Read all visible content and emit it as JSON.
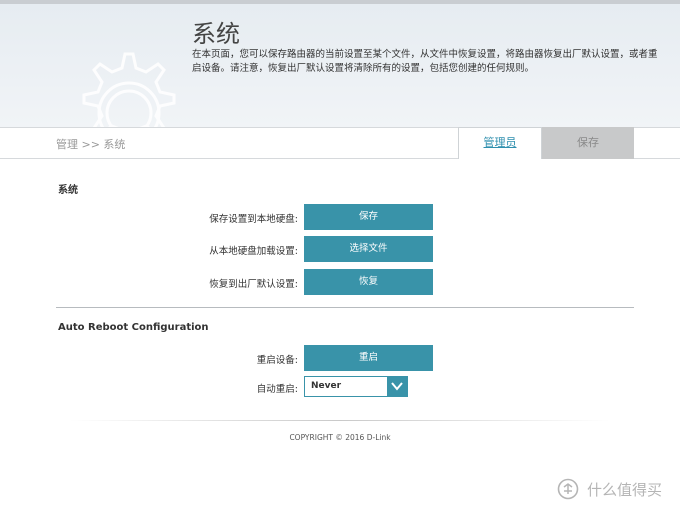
{
  "header": {
    "title": "系统",
    "description": "在本页面，您可以保存路由器的当前设置至某个文件，从文件中恢复设置，将路由器恢复出厂默认设置，或者重启设备。请注意，恢复出厂默认设置将清除所有的设置，包括您创建的任何规则。"
  },
  "breadcrumb": {
    "text": "管理 >> 系统"
  },
  "tabs": {
    "admin": "管理员",
    "save": "保存"
  },
  "system_section": {
    "title": "系统",
    "rows": [
      {
        "label": "保存设置到本地硬盘:",
        "button": "保存"
      },
      {
        "label": "从本地硬盘加载设置:",
        "button": "选择文件"
      },
      {
        "label": "恢复到出厂默认设置:",
        "button": "恢复"
      }
    ]
  },
  "reboot_section": {
    "title": "Auto Reboot Configuration",
    "reboot_label": "重启设备:",
    "reboot_button": "重启",
    "auto_label": "自动重启:",
    "auto_value": "Never"
  },
  "footer": {
    "copyright": "COPYRIGHT © 2016 D-Link"
  },
  "watermark": {
    "text": "什么值得买"
  },
  "colors": {
    "accent": "#3993a9",
    "tab_inactive": "#c8c9ca"
  }
}
